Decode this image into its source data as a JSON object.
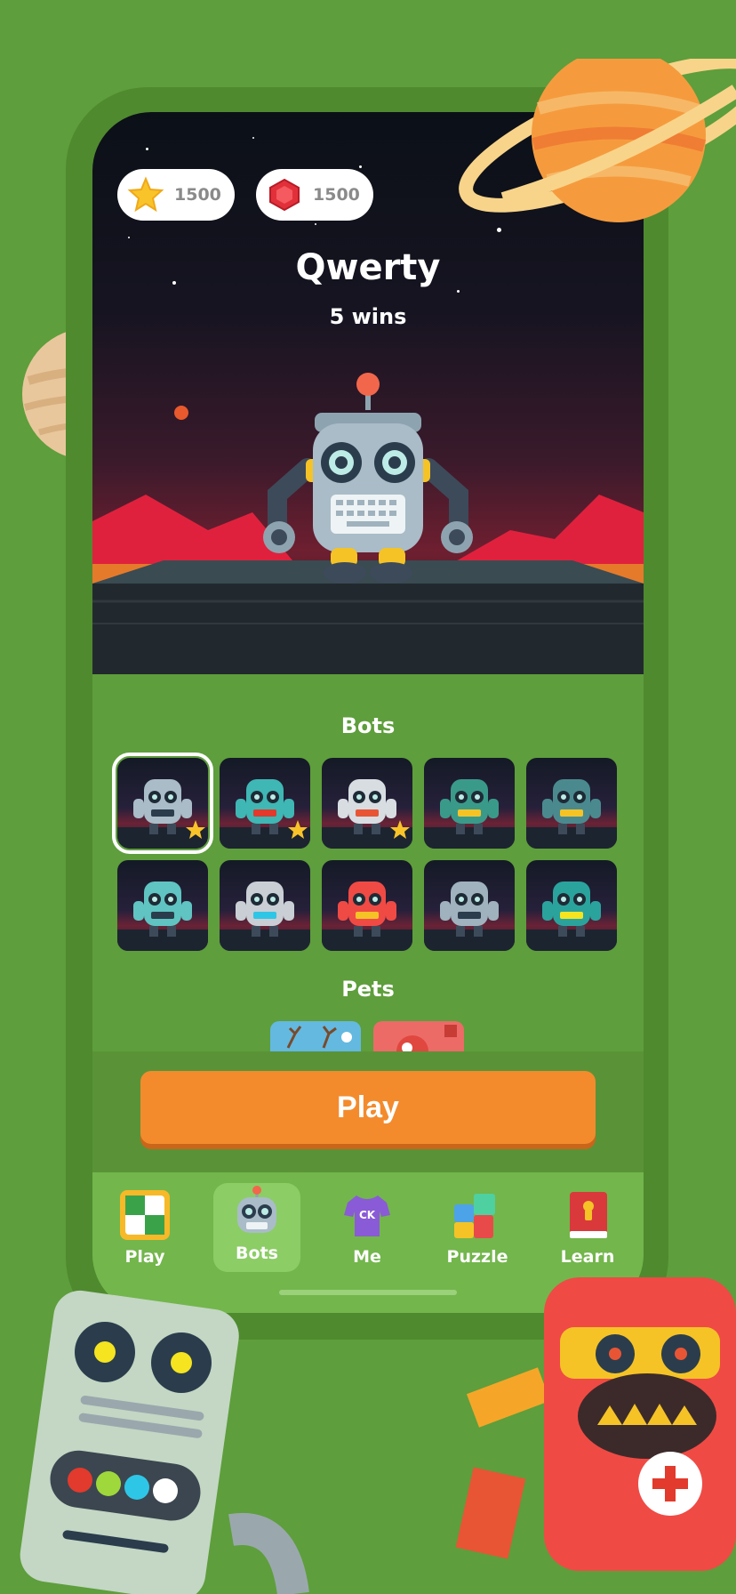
{
  "currency": {
    "coins": "1500",
    "gems": "1500"
  },
  "bot": {
    "name": "Qwerty",
    "wins": "5 wins"
  },
  "sections": {
    "bots_title": "Bots",
    "pets_title": "Pets"
  },
  "play_button": "Play",
  "tabs": [
    {
      "label": "Play",
      "icon": "chessboard-icon"
    },
    {
      "label": "Bots",
      "icon": "robot-icon",
      "active": true
    },
    {
      "label": "Me",
      "icon": "tshirt-icon"
    },
    {
      "label": "Puzzle",
      "icon": "puzzle-icon"
    },
    {
      "label": "Learn",
      "icon": "book-icon"
    }
  ],
  "bot_grid": {
    "rows": 2,
    "per_row": 5,
    "selected_index": 0,
    "starred": [
      0,
      1,
      2
    ]
  },
  "colors": {
    "background": "#5e9e3c",
    "play_button": "#f38b2d",
    "tabbar": "#73b64c",
    "active_tab": "#8ccd66"
  }
}
